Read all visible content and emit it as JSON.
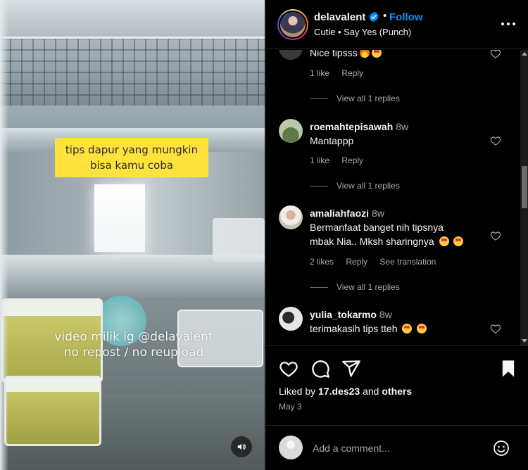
{
  "video": {
    "caption_line1": "tips dapur yang mungkin",
    "caption_line2": "bisa kamu coba",
    "watermark_line1": "video milik ig @delavalent",
    "watermark_line2": "no repost / no reupload",
    "mute_icon": "speaker-icon"
  },
  "header": {
    "username": "delavalent",
    "verified": true,
    "separator": "•",
    "follow_label": "Follow",
    "audio": "Cutie • Say Yes (Punch)",
    "more_icon": "more-horizontal-icon"
  },
  "comments": [
    {
      "username": "",
      "time": "",
      "text": "Nice tipsss",
      "emojis": [
        "fire",
        "heart-eyes"
      ],
      "likes": "1 like",
      "reply": "Reply",
      "view_replies": "View all 1 replies"
    },
    {
      "username": "roemahtepisawah",
      "time": "8w",
      "text": "Mantappp",
      "emojis": [],
      "likes": "1 like",
      "reply": "Reply",
      "view_replies": "View all 1 replies"
    },
    {
      "username": "amaliahfaozi",
      "time": "8w",
      "text_line1": "Bermanfaat banget nih tipsnya",
      "text_line2": "mbak Nia.. Mksh sharingnya",
      "emojis": [
        "heart-eyes",
        "heart-eyes"
      ],
      "likes": "2 likes",
      "reply": "Reply",
      "see_translation": "See translation",
      "view_replies": "View all 1 replies"
    },
    {
      "username": "yulia_tokarmo",
      "time": "8w",
      "text": "terimakasih tips tteh",
      "emojis": [
        "heart-eyes",
        "heart-eyes"
      ]
    }
  ],
  "actions": {
    "like_icon": "heart-icon",
    "comment_icon": "comment-icon",
    "share_icon": "send-icon",
    "save_icon": "bookmark-icon",
    "liked_by_prefix": "Liked by ",
    "liked_by_user": "17.des23",
    "liked_by_and": " and ",
    "liked_by_others": "others",
    "date": "May 3"
  },
  "add_comment": {
    "placeholder": "Add a comment...",
    "emoji_icon": "smiley-icon"
  },
  "colors": {
    "background": "#000000",
    "text": "#f5f5f5",
    "secondary_text": "#a8a8a8",
    "follow_blue": "#0095f6",
    "divider": "#262626",
    "caption_yellow": "#ffe23b"
  }
}
